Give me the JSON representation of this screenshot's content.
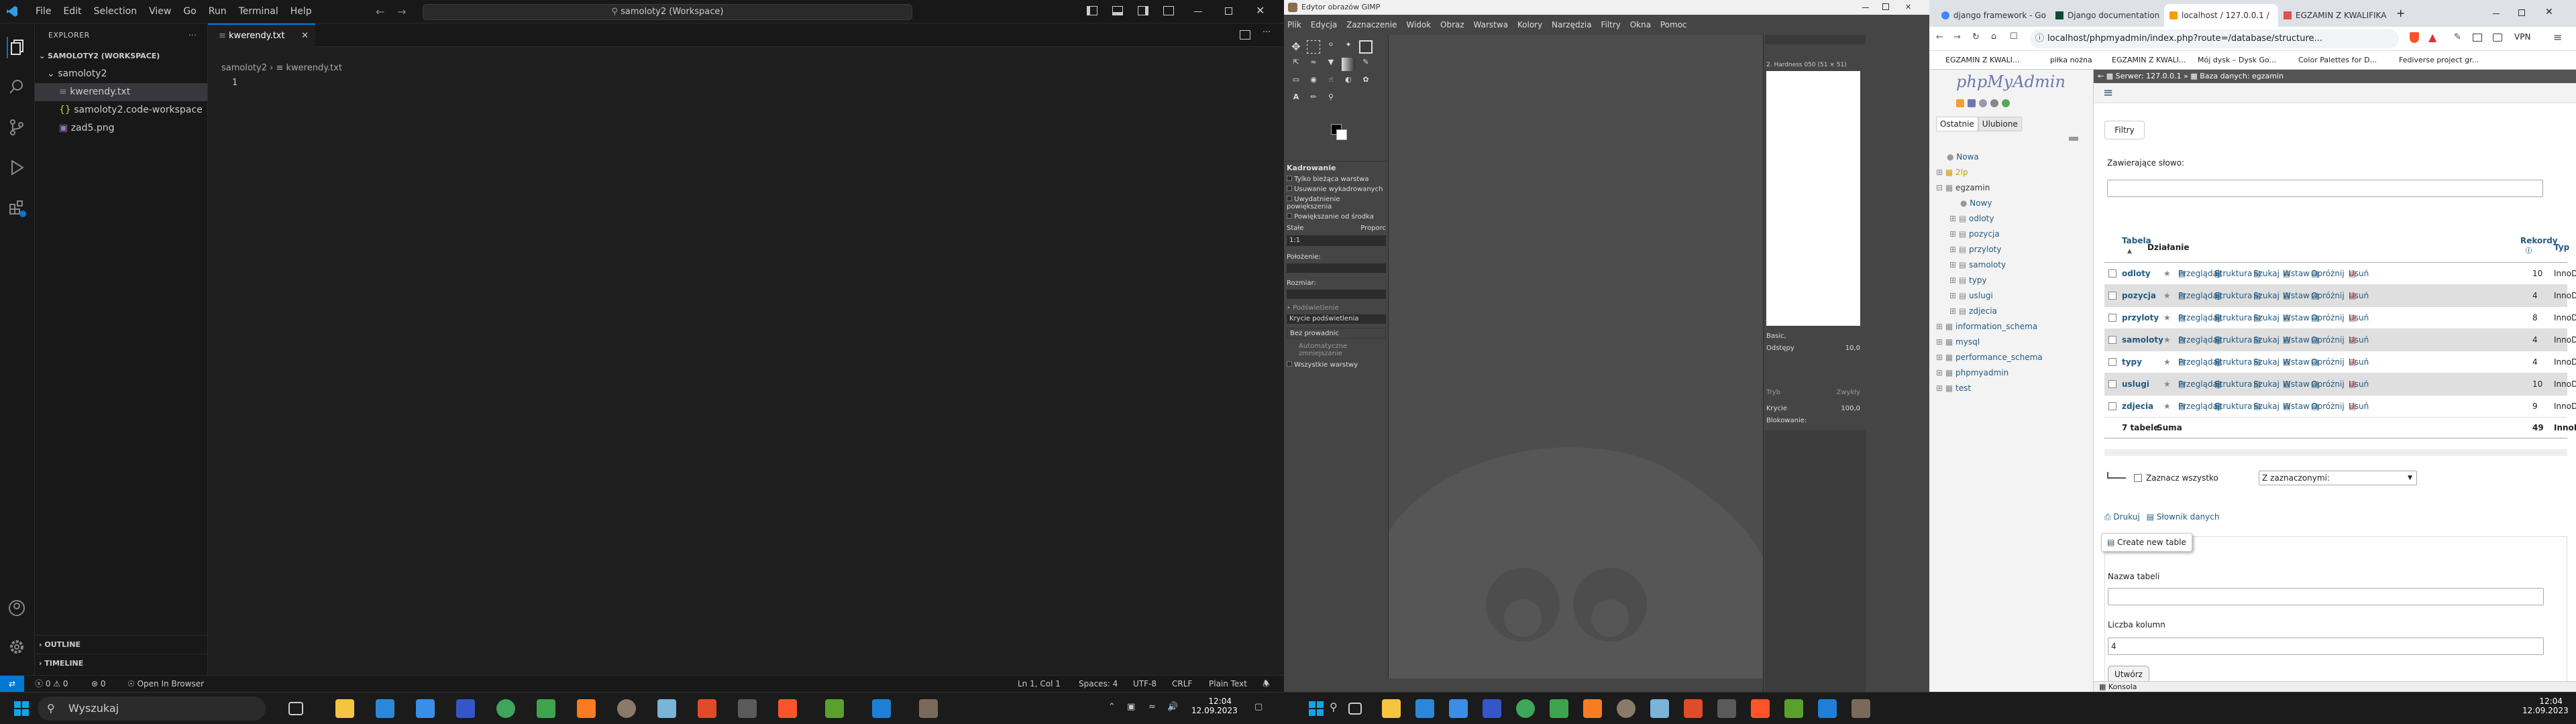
{
  "vscode": {
    "menu": [
      "File",
      "Edit",
      "Selection",
      "View",
      "Go",
      "Run",
      "Terminal",
      "Help"
    ],
    "search": "samoloty2 (Workspace)",
    "explorer_title": "EXPLORER",
    "workspace": "SAMOLOTY2 (WORKSPACE)",
    "folder": "samoloty2",
    "files": [
      "kwerendy.txt",
      "samoloty2.code-workspace",
      "zad5.png"
    ],
    "outline": "OUTLINE",
    "timeline": "TIMELINE",
    "tab": "kwerendy.txt",
    "breadcrumb_root": "samoloty2",
    "breadcrumb_file": "kwerendy.txt",
    "line_number": "1",
    "status": {
      "errors": "0",
      "warnings": "0",
      "ports": "0",
      "open_browser": "Open In Browser",
      "position": "Ln 1, Col 1",
      "spaces": "Spaces: 4",
      "encoding": "UTF-8",
      "eol": "CRLF",
      "language": "Plain Text"
    },
    "colors": {
      "accent": "#0078d4"
    }
  },
  "gimp": {
    "title": "Edytor obrazów GIMP",
    "menu": [
      "Plik",
      "Edycja",
      "Zaznaczenie",
      "Widok",
      "Obraz",
      "Warstwa",
      "Kolory",
      "Narzędzia",
      "Filtry",
      "Okna",
      "Pomoc"
    ],
    "options_title": "Kadrowanie",
    "options": [
      "Tylko bieżąca warstwa",
      "Usuwanie wykadrowanych",
      "Uwydatnienie powiększenia",
      "Powiększanie od środka"
    ],
    "fixed_label": "Stałe",
    "fixed_value": "Proporc",
    "ratio": "1:1",
    "position_label": "Położenie:",
    "size_label": "Rozmiar:",
    "highlight_label": "Podświetlenie",
    "opacity_label": "Krycie podświetlenia",
    "guides_label": "Bez prowadnic",
    "auto_shrink": "Automatyczne zmniejszanie",
    "merge_label": "Wszystkie warstwy",
    "brush_label": "2. Hardness 050 (51 × 51)",
    "brush_preset": "Basic,",
    "spacing_label": "Odstępy",
    "spacing_value": "10,0",
    "mode_label": "Tryb",
    "mode_value": "Zwykły",
    "opacity2_label": "Krycie",
    "opacity2_value": "100,0",
    "lock_label": "Blokowanie:"
  },
  "browser": {
    "tabs": [
      "django framework - Go",
      "Django documentation",
      "localhost / 127.0.0.1 /",
      "EGZAMIN Z KWALIFIKA"
    ],
    "url": "localhost/phpmyadmin/index.php?route=/database/structure...",
    "vpn": "VPN",
    "bookmarks": [
      "EGZAMIN Z KWALI...",
      "piłka nożna",
      "EGZAMIN Z KWALI...",
      "Mój dysk – Dysk Go...",
      "Color Palettes for D...",
      "Fediverse project gr..."
    ]
  },
  "pma": {
    "logo": "phpMyAdmin",
    "tab_recent": "Ostatnie",
    "tab_fav": "Ulubione",
    "tree": [
      "Nowa",
      "2lp",
      "egzamin",
      "Nowy",
      "odloty",
      "pozycja",
      "przyloty",
      "samoloty",
      "typy",
      "uslugi",
      "zdjecia",
      "information_schema",
      "mysql",
      "performance_schema",
      "phpmyadmin",
      "test"
    ],
    "breadcrumb_server": "Serwer: 127.0.0.1",
    "breadcrumb_db": "Baza danych: egzamin",
    "filters": "Filtry",
    "contains_label": "Zawierające słowo:",
    "col_table": "Tabela",
    "col_action": "Działanie",
    "col_rows": "Rekordy",
    "col_type": "Typ",
    "actions": [
      "Przeglądaj",
      "Struktura",
      "Szukaj",
      "Wstaw",
      "Opróżnij",
      "Usuń"
    ],
    "tables": [
      {
        "name": "odloty",
        "rows": "10",
        "type": "InnoDB"
      },
      {
        "name": "pozycja",
        "rows": "4",
        "type": "InnoDB"
      },
      {
        "name": "przyloty",
        "rows": "8",
        "type": "InnoDB"
      },
      {
        "name": "samoloty",
        "rows": "4",
        "type": "InnoDB"
      },
      {
        "name": "typy",
        "rows": "4",
        "type": "InnoDB"
      },
      {
        "name": "uslugi",
        "rows": "10",
        "type": "InnoDB"
      },
      {
        "name": "zdjecia",
        "rows": "9",
        "type": "InnoDB"
      }
    ],
    "summary_tables": "7 tabele",
    "summary_label": "Suma",
    "summary_rows": "49",
    "summary_type": "InnoDB",
    "check_all": "Zaznacz wszystko",
    "with_selected": "Z zaznaczonymi:",
    "print": "Drukuj",
    "dictionary": "Słownik danych",
    "create_table": "Create new table",
    "table_name_label": "Nazwa tabeli",
    "columns_label": "Liczba kolumn",
    "columns_value": "4",
    "create_button": "Utwórz",
    "console": "Konsola"
  },
  "taskbar": {
    "search": "Wyszukaj",
    "time_left": "12:04",
    "date_left": "12.09.2023",
    "time_right": "12:04",
    "date_right": "12.09.2023"
  }
}
